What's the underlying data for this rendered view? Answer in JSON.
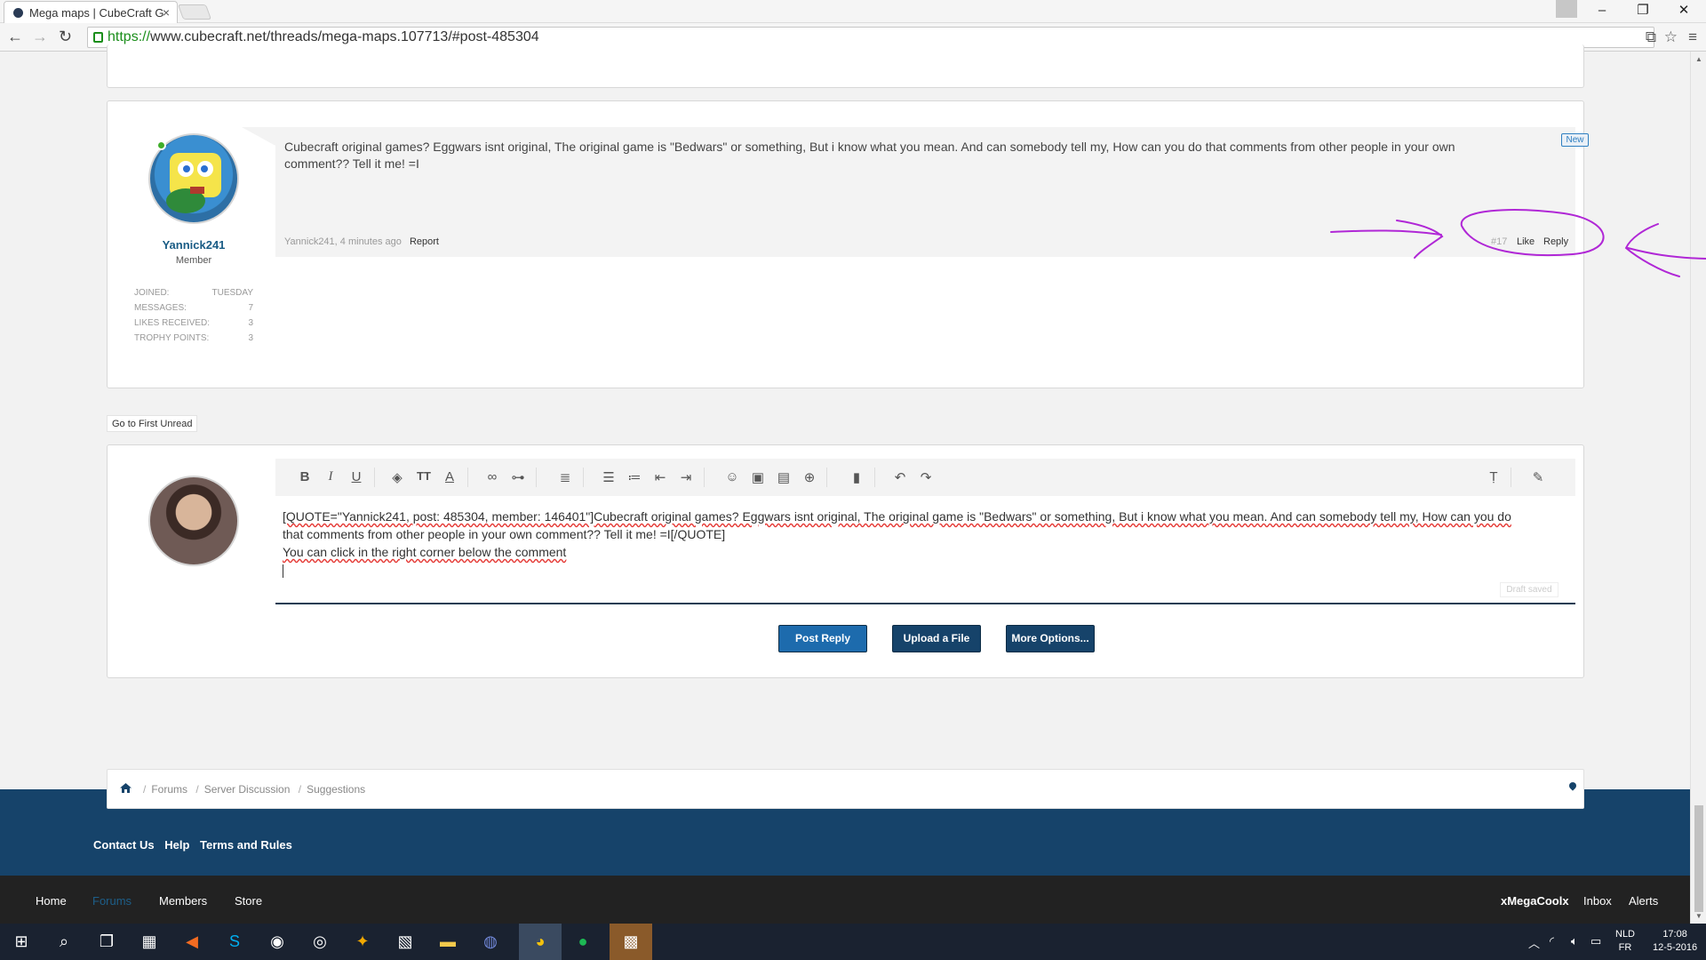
{
  "browser": {
    "tab_title": "Mega maps | CubeCraft G",
    "url_scheme": "https://",
    "url_rest": "www.cubecraft.net/threads/mega-maps.107713/#post-485304"
  },
  "post": {
    "username": "Yannick241",
    "user_title": "Member",
    "stats": [
      {
        "label": "Joined:",
        "value": "Tuesday"
      },
      {
        "label": "Messages:",
        "value": "7"
      },
      {
        "label": "Likes Received:",
        "value": "3"
      },
      {
        "label": "Trophy Points:",
        "value": "3"
      }
    ],
    "message": "Cubecraft original games? Eggwars isnt original, The original game is \"Bedwars\" or something, But i know what you mean. And can somebody tell my, How can you do that comments from other people in your own comment?? Tell it me! =I",
    "badge": "New",
    "meta": "Yannick241, 4 minutes ago",
    "report_label": "Report",
    "post_number": "#17",
    "like_label": "Like",
    "reply_label": "Reply"
  },
  "go_to_first_unread": "Go to First Unread",
  "editor": {
    "line1": "[QUOTE=\"Yannick241, post: 485304, member: 146401\"]Cubecraft original games? Eggwars isnt original, The original game is \"Bedwars\" or something, But i know what you mean. And can somebody tell my, How can you do",
    "line2": "that comments from other people in your own comment?? Tell it me! =I[/QUOTE]",
    "line3": "You can click in the right corner below the comment",
    "draft_saved": "Draft saved",
    "buttons": {
      "post_reply": "Post Reply",
      "upload": "Upload a File",
      "more_options": "More Options..."
    }
  },
  "breadcrumb": [
    "Forums",
    "Server Discussion",
    "Suggestions"
  ],
  "footer_links": [
    "Contact Us",
    "Help",
    "Terms and Rules"
  ],
  "navbar": {
    "home": "Home",
    "forums": "Forums",
    "members": "Members",
    "store": "Store",
    "user": "xMegaCoolx",
    "inbox": "Inbox",
    "alerts": "Alerts"
  },
  "taskbar": {
    "lang_top": "NLD",
    "lang_bottom": "FR",
    "time": "17:08",
    "date": "12-5-2016"
  },
  "colors": {
    "brand_blue": "#16436a",
    "annotation": "#b027d6"
  }
}
